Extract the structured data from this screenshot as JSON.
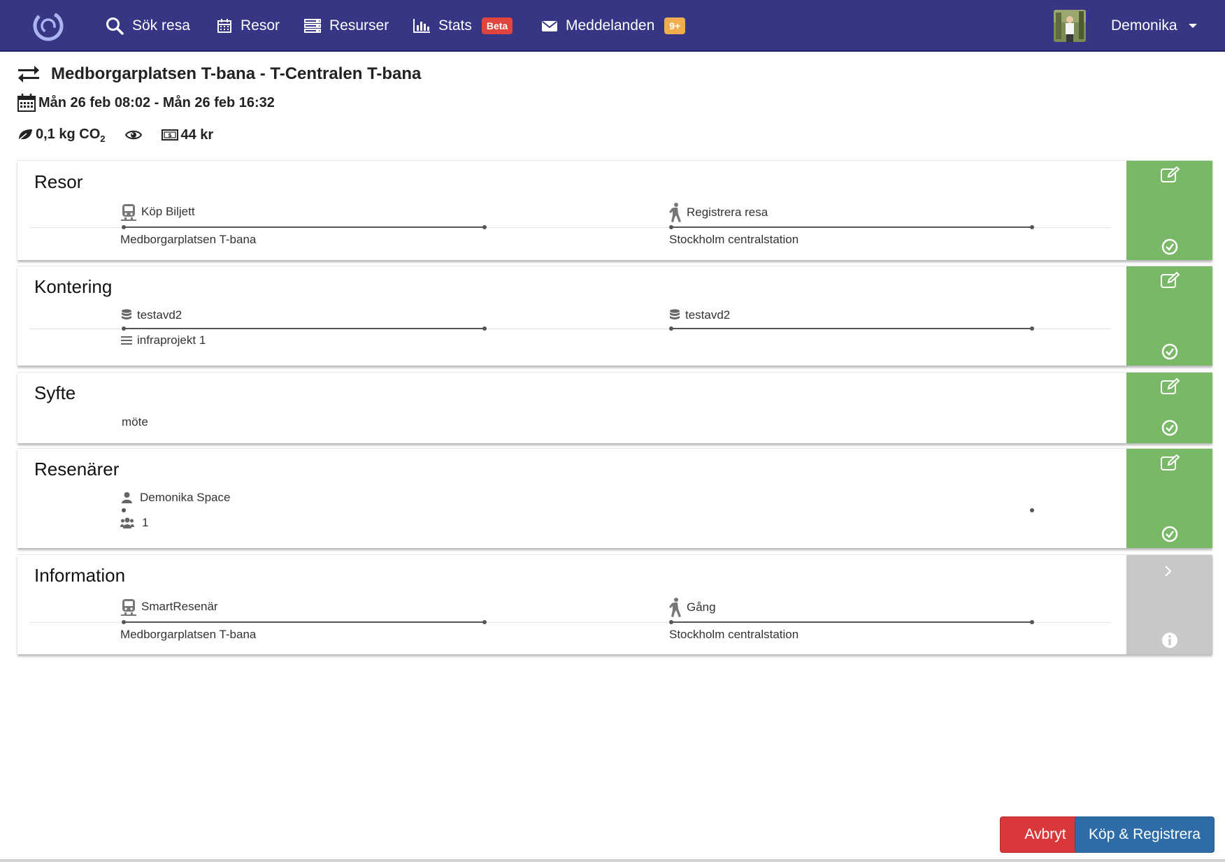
{
  "nav": {
    "items": [
      {
        "label": "Sök resa",
        "icon": "search-icon"
      },
      {
        "label": "Resor",
        "icon": "calendar-icon"
      },
      {
        "label": "Resurser",
        "icon": "server-icon"
      },
      {
        "label": "Stats",
        "icon": "bar-chart-icon",
        "badge": "Beta"
      },
      {
        "label": "Meddelanden",
        "icon": "envelope-icon",
        "badge": "9+"
      }
    ],
    "user": "Demonika"
  },
  "trip": {
    "title": "Medborgarplatsen T-bana - T-Centralen T-bana",
    "dates": "Mån 26 feb 08:02 - Mån 26 feb 16:32",
    "co2_value": "0,1 kg CO",
    "co2_sub": "2",
    "price": "44 kr"
  },
  "sections": {
    "resor": {
      "heading": "Resor",
      "leg1_top": "Köp Biljett",
      "leg1_bottom": "Medborgarplatsen T-bana",
      "leg2_top": "Registrera resa",
      "leg2_bottom": "Stockholm centralstation"
    },
    "kontering": {
      "heading": "Kontering",
      "leg1_top": "testavd2",
      "leg1_bottom": "infraprojekt 1",
      "leg2_top": "testavd2"
    },
    "syfte": {
      "heading": "Syfte",
      "value": "möte"
    },
    "resenarer": {
      "heading": "Resenärer",
      "traveler": "Demonika Space",
      "count": "1"
    },
    "information": {
      "heading": "Information",
      "leg1_top": "SmartResenär",
      "leg1_bottom": "Medborgarplatsen T-bana",
      "leg2_top": "Gång",
      "leg2_bottom": "Stockholm centralstation"
    }
  },
  "buttons": {
    "cancel": "Avbryt",
    "confirm": "Köp & Registrera"
  },
  "colors": {
    "navbar": "#363685",
    "section_done": "#78b866",
    "section_pending": "#c8c8c8",
    "cancel": "#d9373a",
    "confirm": "#2d6ca6"
  }
}
